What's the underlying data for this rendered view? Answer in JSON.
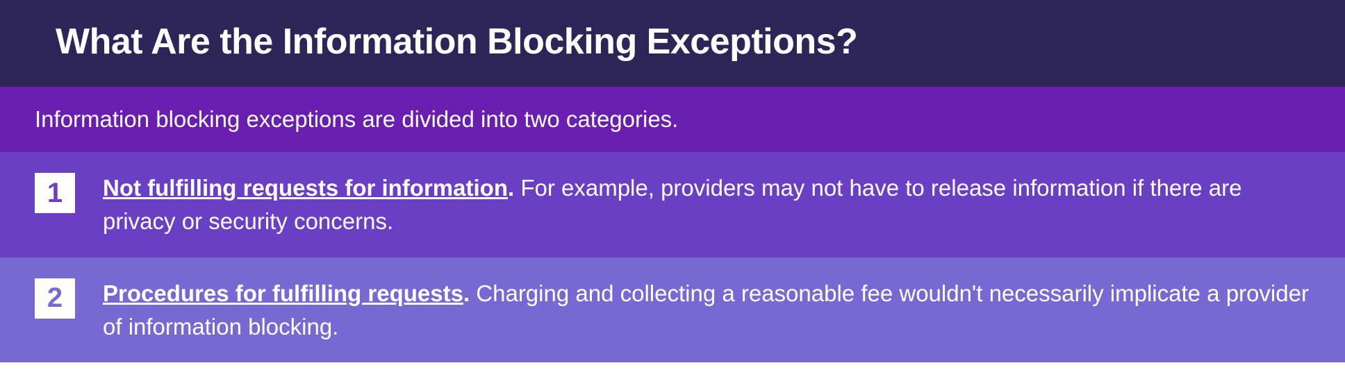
{
  "header": {
    "title": "What Are the Information Blocking Exceptions?"
  },
  "intro": "Information blocking exceptions are divided into two categories.",
  "items": [
    {
      "number": "1",
      "lead": "Not fulfilling requests for information",
      "body": " For example, providers may not have to release information if there are privacy or security concerns."
    },
    {
      "number": "2",
      "lead": "Procedures for fulfilling requests",
      "body": " Charging and collecting a reasonable fee wouldn't necessarily implicate a provider of information blocking."
    }
  ]
}
